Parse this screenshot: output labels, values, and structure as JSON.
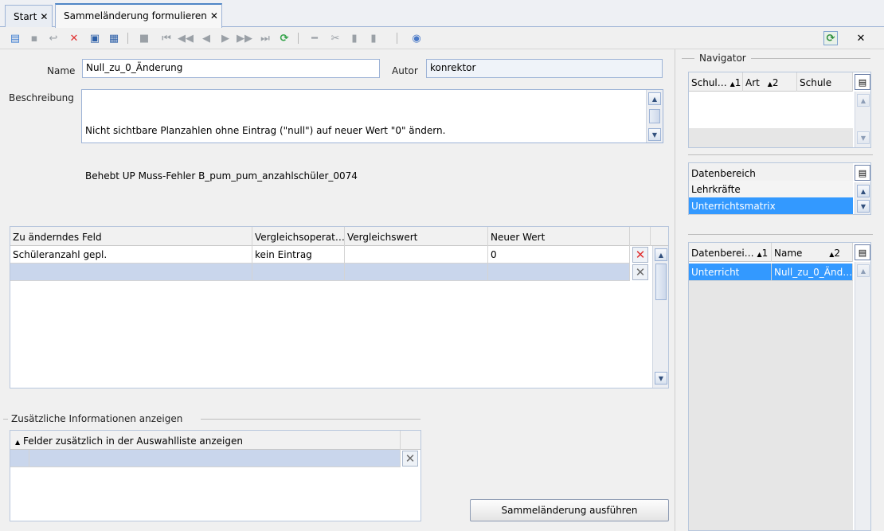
{
  "tabs": [
    {
      "label": "Start"
    },
    {
      "label": "Sammeländerung formulieren"
    }
  ],
  "toolbar": {
    "icons": [
      "new-icon",
      "save-icon",
      "undo-icon",
      "delete-icon",
      "select-icon",
      "print-icon",
      "copy-icon",
      "first-icon",
      "prev-page-icon",
      "prev-icon",
      "next-icon",
      "next-page-icon",
      "last-icon",
      "refresh-icon",
      "remove-icon",
      "cut-icon",
      "copy2-icon",
      "paste-icon",
      "help-icon"
    ],
    "right_icons": [
      "refresh-window-icon",
      "close-icon"
    ]
  },
  "form": {
    "name_label": "Name",
    "name_value": "Null_zu_0_Änderung",
    "author_label": "Autor",
    "author_value": "konrektor",
    "description_label": "Beschreibung",
    "description_lines": [
      "Nicht sichtbare Planzahlen ohne Eintrag (\"null\") auf neuer Wert \"0\" ändern.",
      "Behebt UP Muss-Fehler B_pum_pum_anzahlschüler_0074"
    ]
  },
  "changes_grid": {
    "headers": [
      "Zu änderndes Feld",
      "Vergleichsoperat…",
      "Vergleichswert",
      "Neuer Wert"
    ],
    "rows": [
      {
        "field": "Schüleranzahl gepl.",
        "operator": "kein Eintrag",
        "compare": "",
        "new_value": "0"
      },
      {
        "field": "",
        "operator": "",
        "compare": "",
        "new_value": ""
      }
    ]
  },
  "extra_info": {
    "group_title": "Zusätzliche Informationen anzeigen",
    "header": "Felder zusätzlich in der Auswahlliste anzeigen"
  },
  "execute_button": "Sammeländerung ausführen",
  "navigator": {
    "title": "Navigator",
    "grid1_headers": [
      {
        "label": "Schul…",
        "sort": "1"
      },
      {
        "label": "Art",
        "sort": "2"
      },
      {
        "label": "Schule",
        "sort": ""
      }
    ],
    "grid2_header": "Datenbereich",
    "grid2_items": [
      "Lehrkräfte",
      "Unterrichtsmatrix"
    ],
    "grid2_selected": 1,
    "grid3_headers": [
      {
        "label": "Datenberei…",
        "sort": "1"
      },
      {
        "label": "Name",
        "sort": "2"
      }
    ],
    "grid3_rows": [
      {
        "area": "Unterricht",
        "name": "Null_zu_0_Änd…"
      }
    ]
  }
}
